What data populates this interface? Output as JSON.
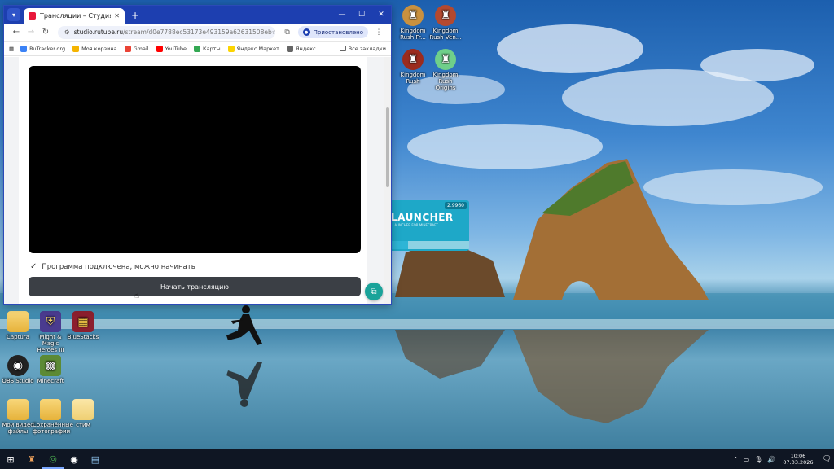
{
  "browser": {
    "tab_title": "Трансляции – Студия RUTUBE",
    "tab_close": "✕",
    "new_tab": "+",
    "window_controls": {
      "minimize": "—",
      "maximize": "☐",
      "close": "✕"
    },
    "url": "studio.rutube.ru",
    "url_path": "/stream/d0e7788ec53173e493159a62631508eb",
    "paused_label": "Приостановлено",
    "bookmarks": [
      {
        "label": "RuTracker.org",
        "color": "#3b82f6"
      },
      {
        "label": "Моя корзина",
        "color": "#f5b400"
      },
      {
        "label": "Gmail",
        "color": "#ea4335"
      },
      {
        "label": "YouTube",
        "color": "#ff0000"
      },
      {
        "label": "Карты",
        "color": "#34a853"
      },
      {
        "label": "Яндекс Маркет",
        "color": "#fcd400"
      },
      {
        "label": "Яндекс",
        "color": "#666666"
      }
    ],
    "all_bookmarks": "Все закладки"
  },
  "page": {
    "status_text": "Программа подключена, можно начинать",
    "start_button": "Начать трансляцию"
  },
  "desktop": {
    "icons_top": [
      {
        "label": "Kingdom Rush Fr..."
      },
      {
        "label": "Kingdom Rush Ven..."
      },
      {
        "label": "Kingdom Rush"
      },
      {
        "label": "Kingdom Rush Origins"
      }
    ],
    "icons_left": [
      {
        "label": "Captura"
      },
      {
        "label": "Might & Magic Heroes III"
      },
      {
        "label": "BlueStacks"
      },
      {
        "label": "OBS Studio"
      },
      {
        "label": "Minecraft"
      },
      {
        "label": "Мои видео файлы"
      },
      {
        "label": "Сохранённые фотографии"
      },
      {
        "label": "стим"
      }
    ],
    "launcher": {
      "name": "LAUNCHER",
      "version": "2.9960",
      "sub": "LAUNCHER FOR MINECRAFT",
      "progress": 0.22
    }
  },
  "taskbar": {
    "time": "10:06",
    "date": "07.03.2026"
  }
}
